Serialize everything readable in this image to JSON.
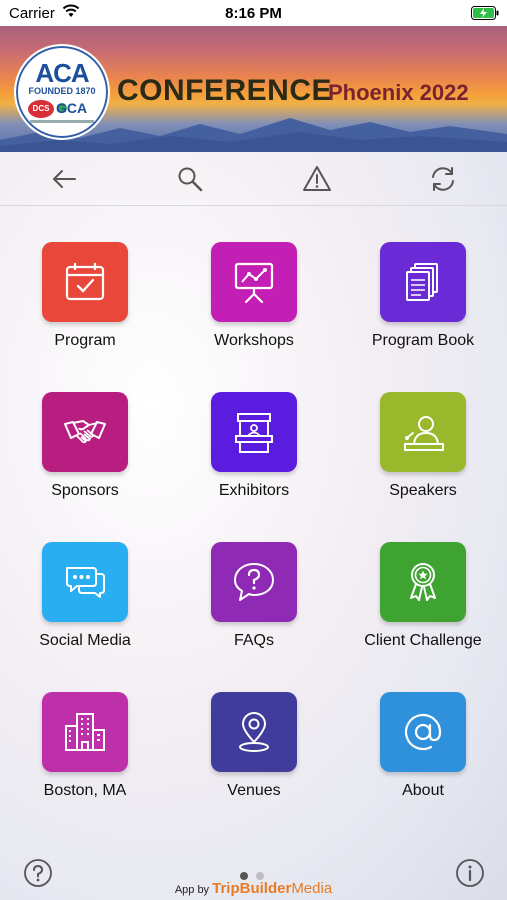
{
  "status_bar": {
    "carrier": "Carrier",
    "time": "8:16 PM"
  },
  "header": {
    "logo": {
      "main": "ACA",
      "founded": "FOUNDED 1870",
      "sub_left": "DCS",
      "sub_right": "GCA"
    },
    "title": "CONFERENCE",
    "location": "Phoenix 2022"
  },
  "toolbar": {
    "icons": [
      "back-arrow-icon",
      "search-icon",
      "alert-icon",
      "refresh-icon"
    ]
  },
  "tiles": [
    {
      "label": "Program",
      "color": "#e8473a",
      "icon": "calendar-check-icon"
    },
    {
      "label": "Workshops",
      "color": "#c41fb5",
      "icon": "presentation-chart-icon"
    },
    {
      "label": "Program Book",
      "color": "#6a2ad6",
      "icon": "documents-icon"
    },
    {
      "label": "Sponsors",
      "color": "#b81e80",
      "icon": "handshake-icon"
    },
    {
      "label": "Exhibitors",
      "color": "#5a1de0",
      "icon": "booth-icon"
    },
    {
      "label": "Speakers",
      "color": "#9ab82c",
      "icon": "speaker-podium-icon"
    },
    {
      "label": "Social Media",
      "color": "#2aaef2",
      "icon": "chat-bubbles-icon"
    },
    {
      "label": "FAQs",
      "color": "#8e2ab4",
      "icon": "question-bubble-icon"
    },
    {
      "label": "Client Challenge",
      "color": "#3fa332",
      "icon": "award-ribbon-icon"
    },
    {
      "label": "Boston, MA",
      "color": "#be30a9",
      "icon": "city-buildings-icon"
    },
    {
      "label": "Venues",
      "color": "#3f3c9c",
      "icon": "map-pin-icon"
    },
    {
      "label": "About",
      "color": "#2f90dc",
      "icon": "at-sign-icon"
    }
  ],
  "footer": {
    "credit_prefix": "App by",
    "credit_brand": "TripBuilder",
    "credit_brand2": "Media",
    "page_dots": {
      "active": 1,
      "total": 2
    }
  }
}
